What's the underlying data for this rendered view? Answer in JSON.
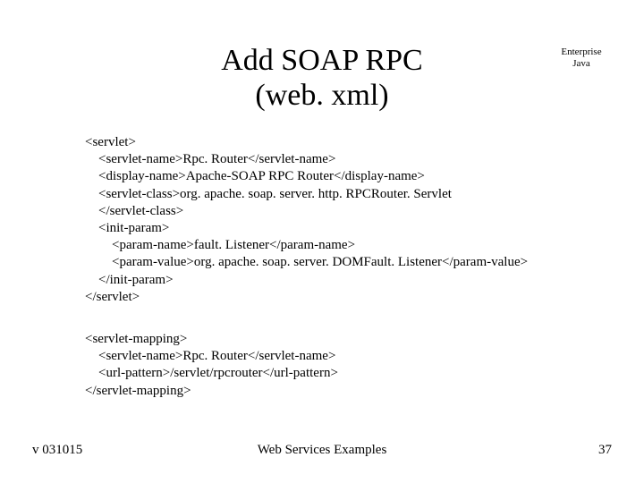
{
  "title": {
    "line1": "Add SOAP RPC",
    "line2": "(web. xml)"
  },
  "corner": {
    "line1": "Enterprise",
    "line2": "Java"
  },
  "code_block_1": "<servlet>\n    <servlet-name>Rpc. Router</servlet-name>\n    <display-name>Apache-SOAP RPC Router</display-name>\n    <servlet-class>org. apache. soap. server. http. RPCRouter. Servlet\n    </servlet-class>\n    <init-param>\n        <param-name>fault. Listener</param-name>\n        <param-value>org. apache. soap. server. DOMFault. Listener</param-value>\n    </init-param>\n</servlet>",
  "code_block_2": "<servlet-mapping>\n    <servlet-name>Rpc. Router</servlet-name>\n    <url-pattern>/servlet/rpcrouter</url-pattern>\n</servlet-mapping>",
  "footer": {
    "left": "v 031015",
    "center": "Web Services Examples",
    "right": "37"
  }
}
